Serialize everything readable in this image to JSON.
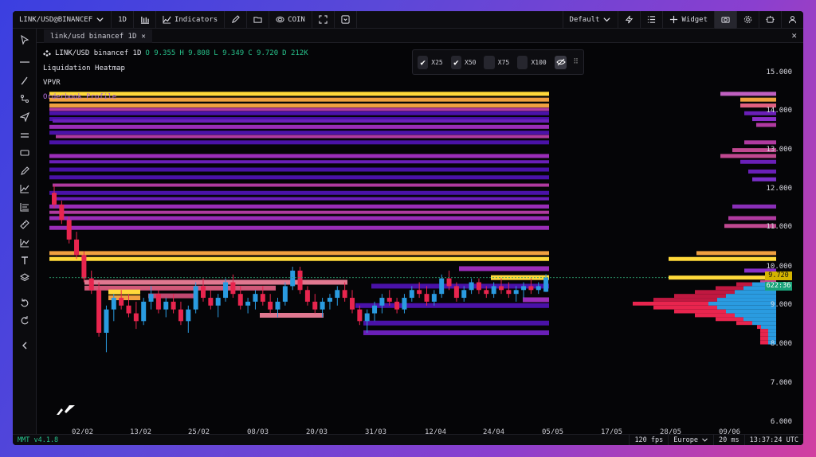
{
  "topbar": {
    "symbol": "LINK/USD@BINANCEF",
    "timeframe": "1D",
    "indicators_label": "Indicators",
    "coin_label": "COIN",
    "layout_label": "Default",
    "widget_label": "Widget"
  },
  "tab": {
    "label": "link/usd binancef 1D"
  },
  "legend": {
    "title": "LINK/USD binancef 1D",
    "o": "O 9.355",
    "h": "H 9.808",
    "l": "L 9.349",
    "c": "C 9.720",
    "d": "D 212K",
    "indicators": [
      "Liquidation Heatmap",
      "VPVR",
      "Orderbook Profile"
    ]
  },
  "leverage_filter": {
    "options": [
      {
        "label": "X25",
        "checked": true
      },
      {
        "label": "X50",
        "checked": true
      },
      {
        "label": "X75",
        "checked": false
      },
      {
        "label": "X100",
        "checked": false
      }
    ]
  },
  "price_axis": [
    "15.000",
    "14.000",
    "13.000",
    "12.000",
    "11.000",
    "10.000",
    "9.000",
    "8.000",
    "7.000",
    "6.000"
  ],
  "last_price": "9.720",
  "countdown": "622:36",
  "date_axis": [
    "02/02",
    "13/02",
    "25/02",
    "08/03",
    "20/03",
    "31/03",
    "12/04",
    "24/04",
    "05/05",
    "17/05",
    "28/05",
    "09/06"
  ],
  "status": {
    "version": "MMT v4.1.8",
    "fps": "120 fps",
    "region": "Europe",
    "latency": "20 ms",
    "clock": "13:37:24 UTC"
  },
  "colors": {
    "up": "#2a9be0",
    "down": "#e8254e",
    "heat_low": "#4a12a8",
    "heat_mid": "#9a2db8",
    "heat_high": "#f0a040",
    "heat_max": "#ffd93a",
    "accent_green": "#27c08a"
  },
  "chart_data": {
    "type": "candlestick",
    "title": "LINK/USD binancef 1D",
    "ylim": [
      6.0,
      15.0
    ],
    "x_ticks": [
      "02/02",
      "13/02",
      "25/02",
      "08/03",
      "20/03",
      "31/03",
      "12/04",
      "24/04",
      "05/05",
      "17/05",
      "28/05",
      "09/06"
    ],
    "last": {
      "open": 9.355,
      "high": 9.808,
      "low": 9.349,
      "close": 9.72
    },
    "heatmap_levels": [
      {
        "price": 14.45,
        "intensity": "max"
      },
      {
        "price": 14.3,
        "intensity": "high"
      },
      {
        "price": 14.15,
        "intensity": "high"
      },
      {
        "price": 13.95,
        "intensity": "low"
      },
      {
        "price": 13.8,
        "intensity": "low"
      },
      {
        "price": 13.6,
        "intensity": "mid"
      },
      {
        "price": 13.45,
        "intensity": "low"
      },
      {
        "price": 13.2,
        "intensity": "low"
      },
      {
        "price": 12.85,
        "intensity": "mid"
      },
      {
        "price": 12.5,
        "intensity": "low"
      },
      {
        "price": 12.3,
        "intensity": "low"
      },
      {
        "price": 11.9,
        "intensity": "low"
      },
      {
        "price": 11.55,
        "intensity": "mid"
      },
      {
        "price": 11.25,
        "intensity": "mid"
      },
      {
        "price": 11.0,
        "intensity": "mid"
      },
      {
        "price": 10.35,
        "intensity": "high"
      },
      {
        "price": 10.2,
        "intensity": "max"
      }
    ]
  }
}
